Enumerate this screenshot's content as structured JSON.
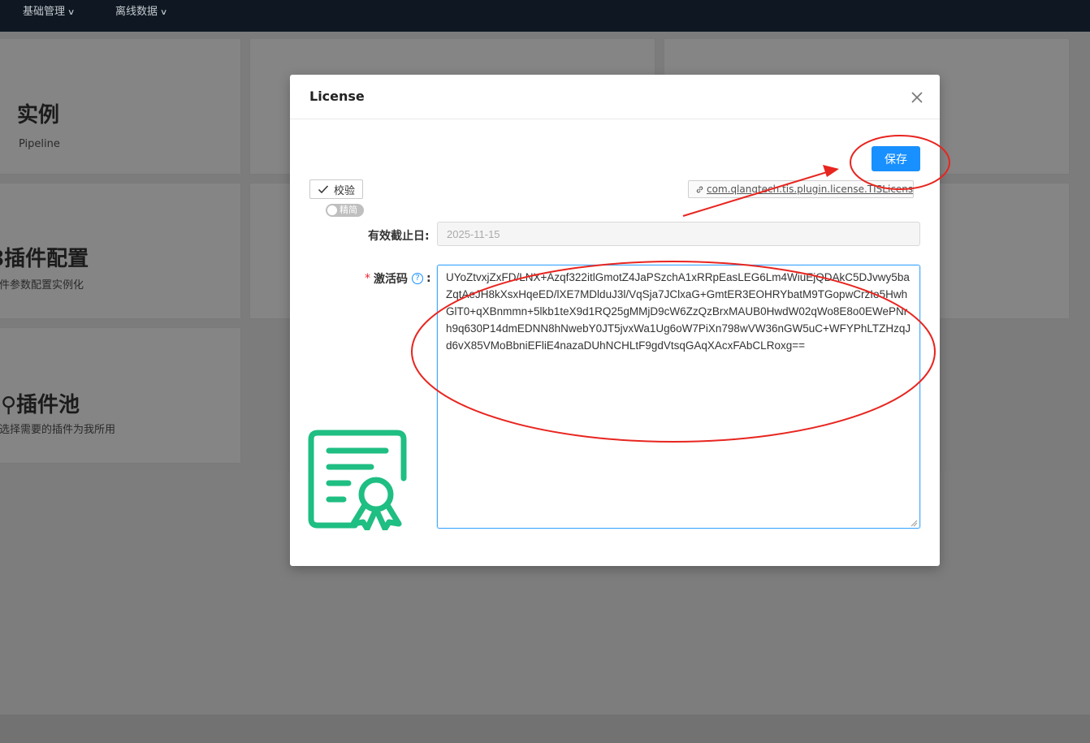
{
  "nav": {
    "items": [
      {
        "label": "基础管理"
      },
      {
        "label": "离线数据"
      }
    ]
  },
  "cards": {
    "instance": {
      "title": "实例",
      "subtitle": "Pipeline"
    },
    "plugin_config": {
      "title": "插件配置",
      "subtitle": "件参数配置实例化"
    },
    "plugin_pool": {
      "title": "插件池",
      "subtitle": "选择需要的插件为我所用"
    }
  },
  "modal": {
    "title": "License",
    "save_label": "保存",
    "verify_label": "校验",
    "toggle_label": "精简",
    "plugin_link": "com.qlangtech.tis.plugin.license.TISLicense",
    "expiry": {
      "label": "有效截止日",
      "colon": ":",
      "value": "2025-11-15"
    },
    "activation": {
      "required_mark": "*",
      "label": "激活码",
      "help": "?",
      "colon": ":",
      "value": "UYoZtvxjZxFD/LNX+Azqf322itlGmotZ4JaPSzchA1xRRpEasLEG6Lm4WiuEjQDAkC5DJvwy5baZqtAeJH8kXsxHqeED/lXE7MDlduJ3l/VqSja7JClxaG+GmtER3EOHRYbatM9TGopwCrzIo5HwhGlT0+qXBnmmn+5lkb1teX9d1RQ25gMMjD9cW6ZzQzBrxMAUB0HwdW02qWo8E8o0EWePNrh9q630P14dmEDNN8hNwebY0JT5jvxWa1Ug6oW7PiXn798wVW36nGW5uC+WFYPhLTZHzqJd6vX85VMoBbniEFliE4nazaDUhNCHLtF9gdVtsqGAqXAcxFAbCLRoxg=="
    }
  },
  "colors": {
    "primary": "#1890ff",
    "annotation": "#e8251f",
    "cert_icon": "#1fbe82",
    "topnav": "#0f1822"
  },
  "icons": [
    "chevron-down-icon",
    "close-icon",
    "check-icon",
    "link-icon",
    "help-icon",
    "certificate-icon"
  ]
}
